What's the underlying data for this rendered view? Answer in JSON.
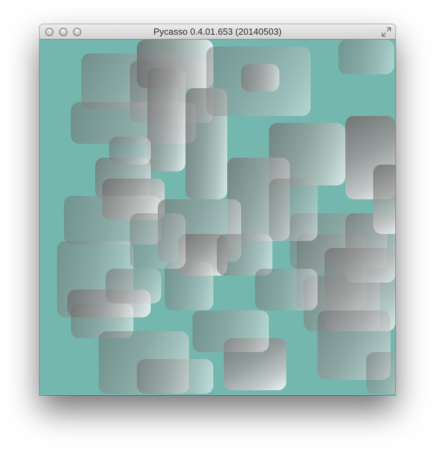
{
  "window": {
    "title": "Pycasso 0.4.01.653 (20140503)"
  },
  "icons": {
    "close": "close-window-icon",
    "minimize": "minimize-window-icon",
    "zoom": "zoom-window-icon",
    "fullscreen": "fullscreen-arrows-icon"
  },
  "colors": {
    "canvas_background": "#74b7ae",
    "shape_light": "#ffffff",
    "shape_dark": "#6e6e6e"
  }
}
